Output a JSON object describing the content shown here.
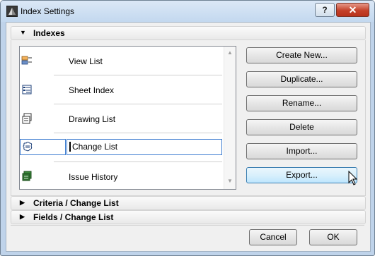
{
  "window": {
    "title": "Index Settings",
    "help_label": "?",
    "close_label": "✕"
  },
  "sections": {
    "indexes": {
      "label": "Indexes",
      "expanded": true
    },
    "criteria": {
      "label": "Criteria /  Change List",
      "expanded": false
    },
    "fields": {
      "label": "Fields /  Change List",
      "expanded": false
    }
  },
  "index_list": {
    "items": [
      {
        "label": "View List",
        "icon": "view-list-icon"
      },
      {
        "label": "Sheet Index",
        "icon": "sheet-index-icon"
      },
      {
        "label": "Drawing List",
        "icon": "drawing-list-icon"
      },
      {
        "label": "Change List",
        "icon": "change-list-icon",
        "selected": true
      },
      {
        "label": "Issue History",
        "icon": "issue-history-icon"
      }
    ]
  },
  "actions": {
    "create_new": "Create New...",
    "duplicate": "Duplicate...",
    "rename": "Rename...",
    "delete": "Delete",
    "import": "Import...",
    "export": "Export..."
  },
  "footer": {
    "cancel": "Cancel",
    "ok": "OK"
  },
  "colors": {
    "accent": "#3b7bd0",
    "title_bar": "#c3d8ef",
    "close_button": "#c4412a"
  }
}
